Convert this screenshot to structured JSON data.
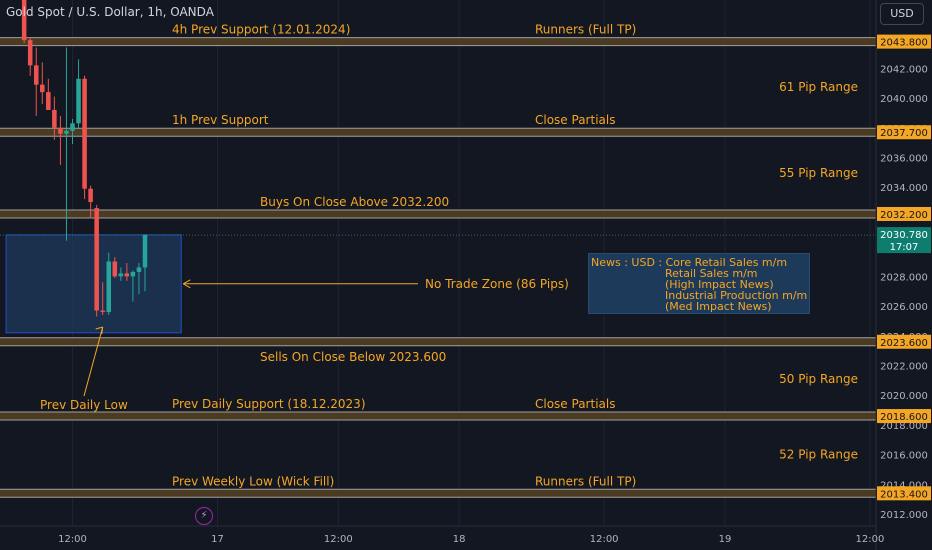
{
  "header": {
    "symbol_title": "Gold Spot / U.S. Dollar, 1h, OANDA",
    "currency_button": "USD"
  },
  "colors": {
    "background": "#131722",
    "grid": "#1f2430",
    "text": "#d1d4dc",
    "up": "#26a69a",
    "down": "#ef5350",
    "level_line": "#a0a0a0",
    "level_fill": "#4a3b22",
    "annotation": "#f5a623",
    "zone_fill": "#1d3a5c",
    "zone_border": "#2962ff",
    "price_label_bg": "#f5a623",
    "current_label_bg": "#0d7d70"
  },
  "chart_data": {
    "type": "candlestick",
    "title": "Gold Spot / U.S. Dollar, 1h, OANDA",
    "x_ticks": [
      "12:00",
      "17",
      "12:00",
      "18",
      "12:00",
      "19",
      "12:00"
    ],
    "y_ticks": [
      2012,
      2014,
      2016,
      2018,
      2020,
      2022,
      2024,
      2026,
      2028,
      2030,
      2032,
      2034,
      2036,
      2038,
      2040,
      2042
    ],
    "y_tick_labels": [
      "2012.000",
      "2014.000",
      "2016.000",
      "2018.000",
      "2020.000",
      "2022.000",
      "2024.000",
      "2026.000",
      "2028.000",
      "2030.000",
      "2032.000",
      "2034.000",
      "2036.000",
      "2038.000",
      "2040.000",
      "2042.000"
    ],
    "ylim": [
      2011.2,
      2046.6
    ],
    "x_range_bars": [
      -4,
      141
    ],
    "time_axis_bars": [
      8,
      32,
      52,
      72,
      96,
      116,
      140
    ],
    "candles": [
      {
        "i": 0,
        "o": 2046.8,
        "h": 2046.9,
        "l": 2043.7,
        "c": 2043.9
      },
      {
        "i": 1,
        "o": 2043.9,
        "h": 2044.1,
        "l": 2041.5,
        "c": 2042.2
      },
      {
        "i": 2,
        "o": 2042.2,
        "h": 2043.4,
        "l": 2038.8,
        "c": 2040.9
      },
      {
        "i": 3,
        "o": 2040.9,
        "h": 2042.4,
        "l": 2039.6,
        "c": 2040.4
      },
      {
        "i": 4,
        "o": 2040.4,
        "h": 2041.3,
        "l": 2039.2,
        "c": 2039.2
      },
      {
        "i": 5,
        "o": 2039.2,
        "h": 2040.1,
        "l": 2037.2,
        "c": 2038.0
      },
      {
        "i": 6,
        "o": 2038.0,
        "h": 2038.8,
        "l": 2035.5,
        "c": 2037.6
      },
      {
        "i": 7,
        "o": 2037.6,
        "h": 2043.4,
        "l": 2030.4,
        "c": 2037.8
      },
      {
        "i": 8,
        "o": 2037.8,
        "h": 2038.6,
        "l": 2036.9,
        "c": 2038.3
      },
      {
        "i": 9,
        "o": 2038.3,
        "h": 2042.6,
        "l": 2038.0,
        "c": 2041.3
      },
      {
        "i": 10,
        "o": 2041.3,
        "h": 2041.5,
        "l": 2033.2,
        "c": 2033.9
      },
      {
        "i": 11,
        "o": 2033.9,
        "h": 2034.1,
        "l": 2031.9,
        "c": 2033.0
      },
      {
        "i": 12,
        "o": 2032.6,
        "h": 2032.8,
        "l": 2025.3,
        "c": 2025.7
      },
      {
        "i": 13,
        "o": 2025.7,
        "h": 2027.6,
        "l": 2025.4,
        "c": 2025.6
      },
      {
        "i": 14,
        "o": 2025.6,
        "h": 2029.6,
        "l": 2025.4,
        "c": 2029.0
      },
      {
        "i": 15,
        "o": 2029.0,
        "h": 2029.3,
        "l": 2027.9,
        "c": 2028.0
      },
      {
        "i": 16,
        "o": 2028.0,
        "h": 2028.6,
        "l": 2027.7,
        "c": 2028.2
      },
      {
        "i": 17,
        "o": 2028.2,
        "h": 2028.9,
        "l": 2027.7,
        "c": 2028.0
      },
      {
        "i": 18,
        "o": 2028.0,
        "h": 2028.4,
        "l": 2026.3,
        "c": 2028.3
      },
      {
        "i": 19,
        "o": 2028.3,
        "h": 2028.9,
        "l": 2026.8,
        "c": 2028.6
      },
      {
        "i": 20,
        "o": 2028.6,
        "h": 2030.8,
        "l": 2027.0,
        "c": 2030.8
      }
    ],
    "levels": [
      {
        "price": 2043.8,
        "label": "2043.800",
        "left_text": "4h Prev Support (12.01.2024)",
        "right_text": "Runners (Full TP)",
        "range_text": "61 Pip Range"
      },
      {
        "price": 2037.7,
        "label": "2037.700",
        "left_text": "1h Prev Support",
        "right_text": "Close Partials",
        "range_text": "55 Pip Range"
      },
      {
        "price": 2032.2,
        "label": "2032.200",
        "left_text": "Buys On Close Above 2032.200",
        "right_text": "",
        "range_text": ""
      },
      {
        "price": 2023.6,
        "label": "2023.600",
        "left_text": "Sells On Close Below 2023.600",
        "right_text": "",
        "range_text": "50 Pip Range"
      },
      {
        "price": 2018.6,
        "label": "2018.600",
        "left_text": "Prev Daily Support (18.12.2023)",
        "right_text": "Close Partials",
        "range_text": "52 Pip Range"
      },
      {
        "price": 2013.4,
        "label": "2013.400",
        "left_text": "Prev Weekly Low (Wick Fill)",
        "right_text": "Runners (Full TP)",
        "range_text": ""
      }
    ],
    "current_price": {
      "price": 2030.78,
      "label": "2030.780",
      "countdown": "17:07"
    },
    "no_trade_zone": {
      "top": 2030.8,
      "bottom": 2024.2,
      "bar_start": -3,
      "bar_end": 26,
      "label": "No Trade Zone (86 Pips)"
    },
    "prev_daily_low_label": "Prev Daily Low",
    "news": {
      "head": "News : USD : Core Retail Sales m/m",
      "lines": [
        "Retail Sales m/m",
        "(High Impact News)",
        "Industrial Production m/m",
        "(Med Impact News)"
      ]
    }
  }
}
